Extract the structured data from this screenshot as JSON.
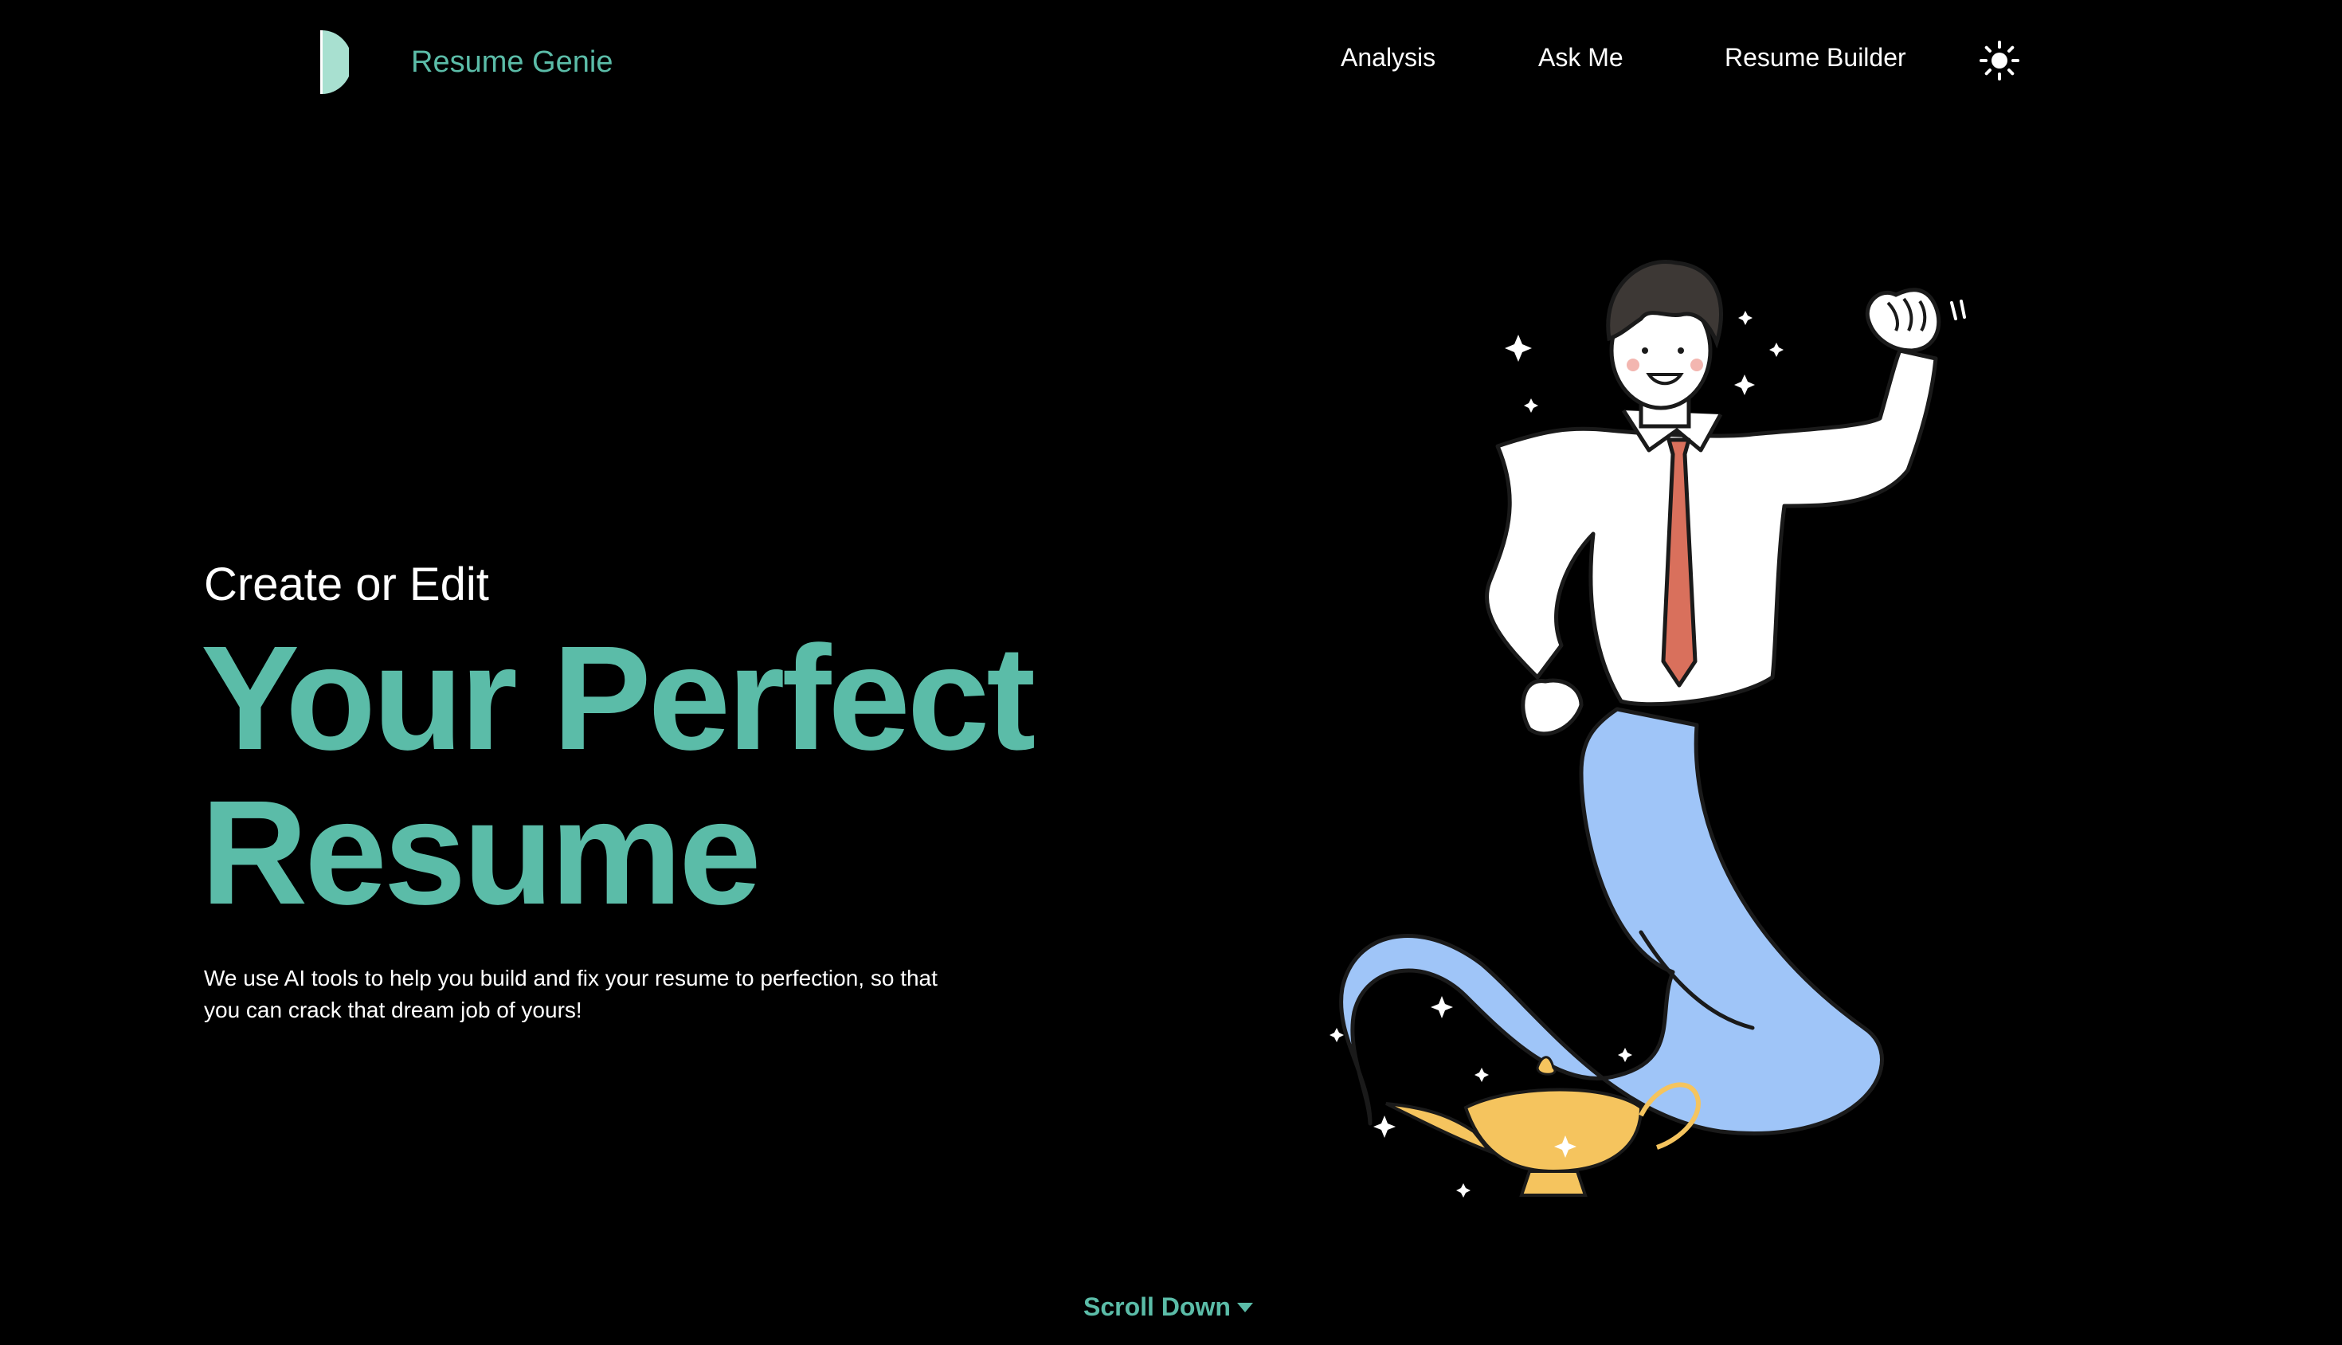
{
  "navbar": {
    "brand": "Resume Genie",
    "links": [
      {
        "label": "Analysis"
      },
      {
        "label": "Ask Me"
      },
      {
        "label": "Resume Builder"
      }
    ],
    "theme_toggle_icon": "sun-icon"
  },
  "hero": {
    "subtitle": "Create or Edit",
    "title_line1": "Your Perfect",
    "title_line2": "Resume",
    "description": "We use AI tools to help you build and fix your resume to perfection, so that you can crack that dream job of yours!"
  },
  "illustration": {
    "name": "genie-lamp-illustration"
  },
  "scroll": {
    "label": "Scroll Down",
    "icon": "caret-down-icon"
  },
  "colors": {
    "background": "#000000",
    "accent": "#5bbca8",
    "text": "#ffffff",
    "genie_tail": "#9fc5f8",
    "lamp": "#f5c45e",
    "tie": "#d9705c"
  }
}
